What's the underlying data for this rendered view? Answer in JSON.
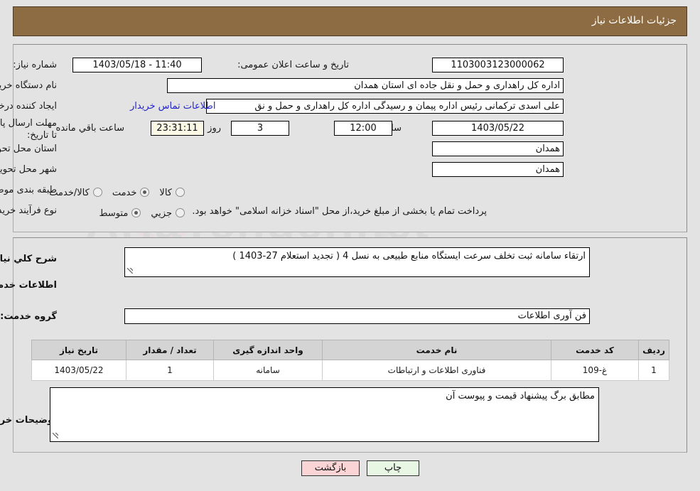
{
  "header": {
    "title": "جزئیات اطلاعات نیاز"
  },
  "form": {
    "need_number_label": "شماره نیاز:",
    "need_number_value": "1103003123000062",
    "announce_label": "تاریخ و ساعت اعلان عمومی:",
    "announce_value": "11:40 - 1403/05/18",
    "buyer_org_label": "نام دستگاه خریدار:",
    "buyer_org_value": "اداره کل راهداری و حمل و نقل جاده ای استان همدان",
    "requester_label": "ایجاد کننده درخواست:",
    "requester_value": "علی اسدی ترکمانی رئیس اداره پیمان و رسیدگی اداره کل راهداری و حمل و نق",
    "contact_link": "اطلاعات تماس خریدار",
    "deadline_label": "مهلت ارسال پاسخ: تا تاریخ:",
    "deadline_date": "1403/05/22",
    "deadline_hour_label": "ساعت",
    "deadline_hour": "12:00",
    "days_value": "3",
    "days_label": "روز و",
    "countdown": "23:31:11",
    "countdown_label": "ساعت باقي مانده",
    "province_label": "استان محل تحویل:",
    "province_value": "همدان",
    "city_label": "شهر محل تحویل:",
    "city_value": "همدان",
    "classification_label": "طبقه بندی موضوعی:",
    "classification_options": [
      {
        "label": "کالا",
        "selected": false
      },
      {
        "label": "خدمت",
        "selected": true
      },
      {
        "label": "کالا/خدمت",
        "selected": false
      }
    ],
    "process_label": "نوع فرآیند خرید :",
    "process_options": [
      {
        "label": "جزیي",
        "selected": false
      },
      {
        "label": "متوسط",
        "selected": true
      }
    ],
    "treasury_note": "پرداخت تمام یا بخشی از مبلغ خرید،از محل \"اسناد خزانه اسلامی\" خواهد بود."
  },
  "detail": {
    "summary_label": "شرح کلي نیاز:",
    "summary_value": "ارتقاء سامانه ثبت تخلف سرعت ایستگاه منابع طبیعی به نسل 4 ( تجدید استعلام 27-1403 )",
    "services_section_title": "اطلاعات خدمات مورد نیاز",
    "service_group_label": "گروه خدمت:",
    "service_group_value": "فن آوری اطلاعات",
    "buyer_notes_label": "توضیحات خریدار:",
    "buyer_notes_value": "مطابق برگ پیشنهاد قیمت و پیوست آن"
  },
  "table": {
    "columns": [
      "ردیف",
      "کد خدمت",
      "نام خدمت",
      "واحد اندازه گیری",
      "تعداد / مقدار",
      "تاریخ نیاز"
    ],
    "rows": [
      {
        "row_no": "1",
        "service_code": "غ-109",
        "service_name": "فناوری اطلاعات و ارتباطات",
        "unit": "سامانه",
        "quantity": "1",
        "need_date": "1403/05/22"
      }
    ]
  },
  "footer": {
    "print_label": "چاپ",
    "back_label": "بازگشت"
  },
  "watermark": {
    "text": "AriaTender.net",
    "check_glyph": "✔"
  },
  "colors": {
    "header_bg": "#8d6c43",
    "page_bg": "#e3e3e3",
    "link": "#2424cc",
    "back_btn": "#fbd5d5",
    "print_btn": "#e8f6e4",
    "countdown_bg": "#fbf8e6"
  }
}
